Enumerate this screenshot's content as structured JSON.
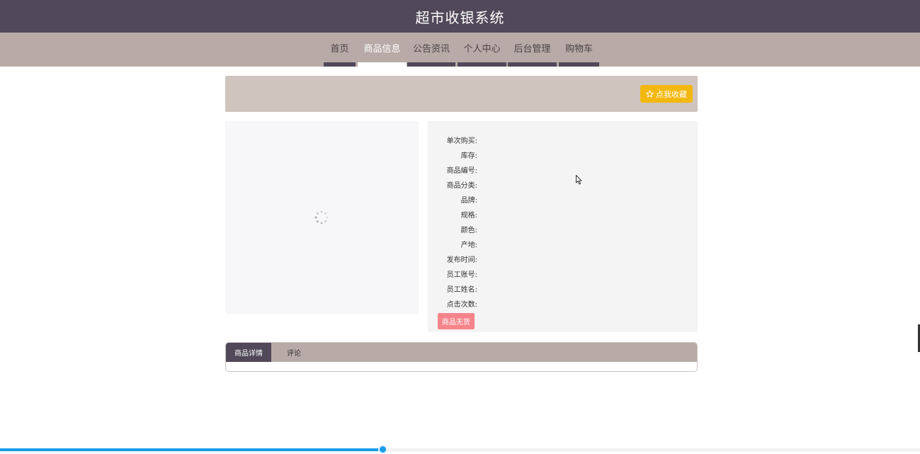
{
  "header": {
    "title": "超市收银系统"
  },
  "nav": {
    "items": [
      {
        "label": "首页",
        "active": false
      },
      {
        "label": "商品信息",
        "active": true
      },
      {
        "label": "公告资讯",
        "active": false
      },
      {
        "label": "个人中心",
        "active": false
      },
      {
        "label": "后台管理",
        "active": false
      },
      {
        "label": "购物车",
        "active": false
      }
    ]
  },
  "favorite": {
    "icon": "star-outline-icon",
    "label": "点我收藏"
  },
  "product_info": {
    "rows": [
      {
        "label": "单次购买:"
      },
      {
        "label": "库存:"
      },
      {
        "label": "商品编号:"
      },
      {
        "label": "商品分类:"
      },
      {
        "label": "品牌:"
      },
      {
        "label": "规格:"
      },
      {
        "label": "颜色:"
      },
      {
        "label": "产地:"
      },
      {
        "label": "发布时间:"
      },
      {
        "label": "员工账号:"
      },
      {
        "label": "员工姓名:"
      },
      {
        "label": "点击次数:"
      }
    ],
    "stock_button": "商品无货"
  },
  "tabs": [
    {
      "label": "商品详情",
      "active": true
    },
    {
      "label": "评论",
      "active": false
    }
  ],
  "progress": {
    "fraction": 0.416
  },
  "colors": {
    "header_bg": "#51495a",
    "nav_bg": "#b8aaa6",
    "accent_yellow": "#f3b80f",
    "out_of_stock": "#f5858a",
    "progress_blue": "#1a9ce8"
  }
}
